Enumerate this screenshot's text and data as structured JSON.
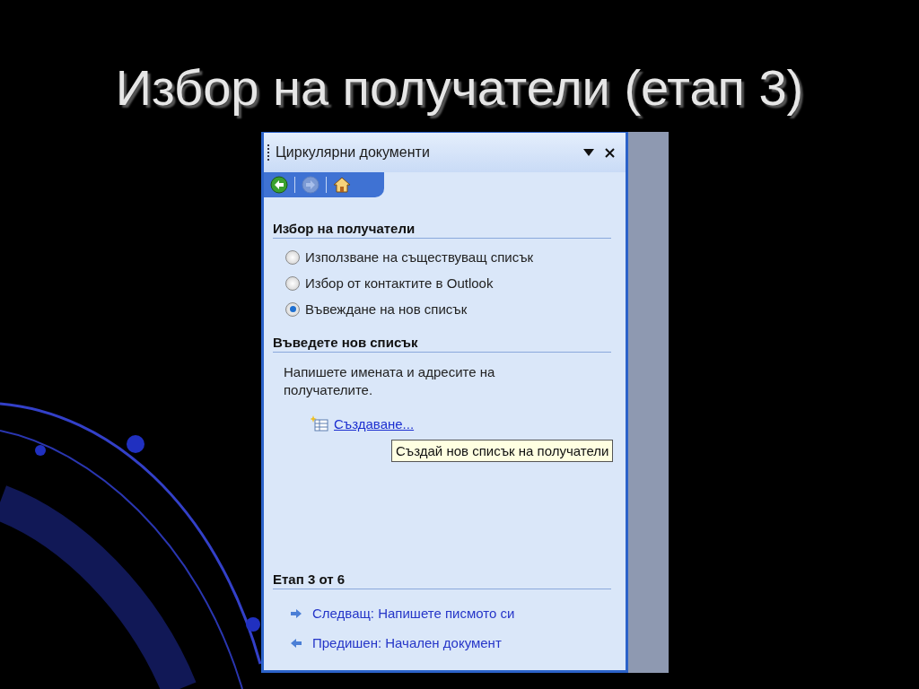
{
  "slide": {
    "title": "Избор на получатели (етап 3)"
  },
  "task_pane": {
    "title": "Циркулярни документи",
    "nav_buttons": [
      {
        "kind": "back",
        "disabled": false
      },
      {
        "kind": "forward",
        "disabled": true
      },
      {
        "kind": "home",
        "disabled": false
      }
    ],
    "recipients_section": {
      "heading": "Избор на получатели",
      "options": [
        {
          "label": "Използване на съществуващ списък",
          "selected": false
        },
        {
          "label": "Избор от контактите в Outlook",
          "selected": false
        },
        {
          "label": "Въвеждане на нов списък",
          "selected": true
        }
      ]
    },
    "new_list_section": {
      "heading": "Въведете нов списък",
      "text": "Напишете имената и адресите на получателите.",
      "link": "Създаване...",
      "tooltip": "Създай нов списък на получатели"
    },
    "step_section": {
      "heading": "Етап 3 от 6",
      "links": [
        {
          "kind": "next",
          "label": "Следващ: Напишете писмото си"
        },
        {
          "kind": "previous",
          "label": "Предишен: Начален документ"
        }
      ]
    }
  }
}
